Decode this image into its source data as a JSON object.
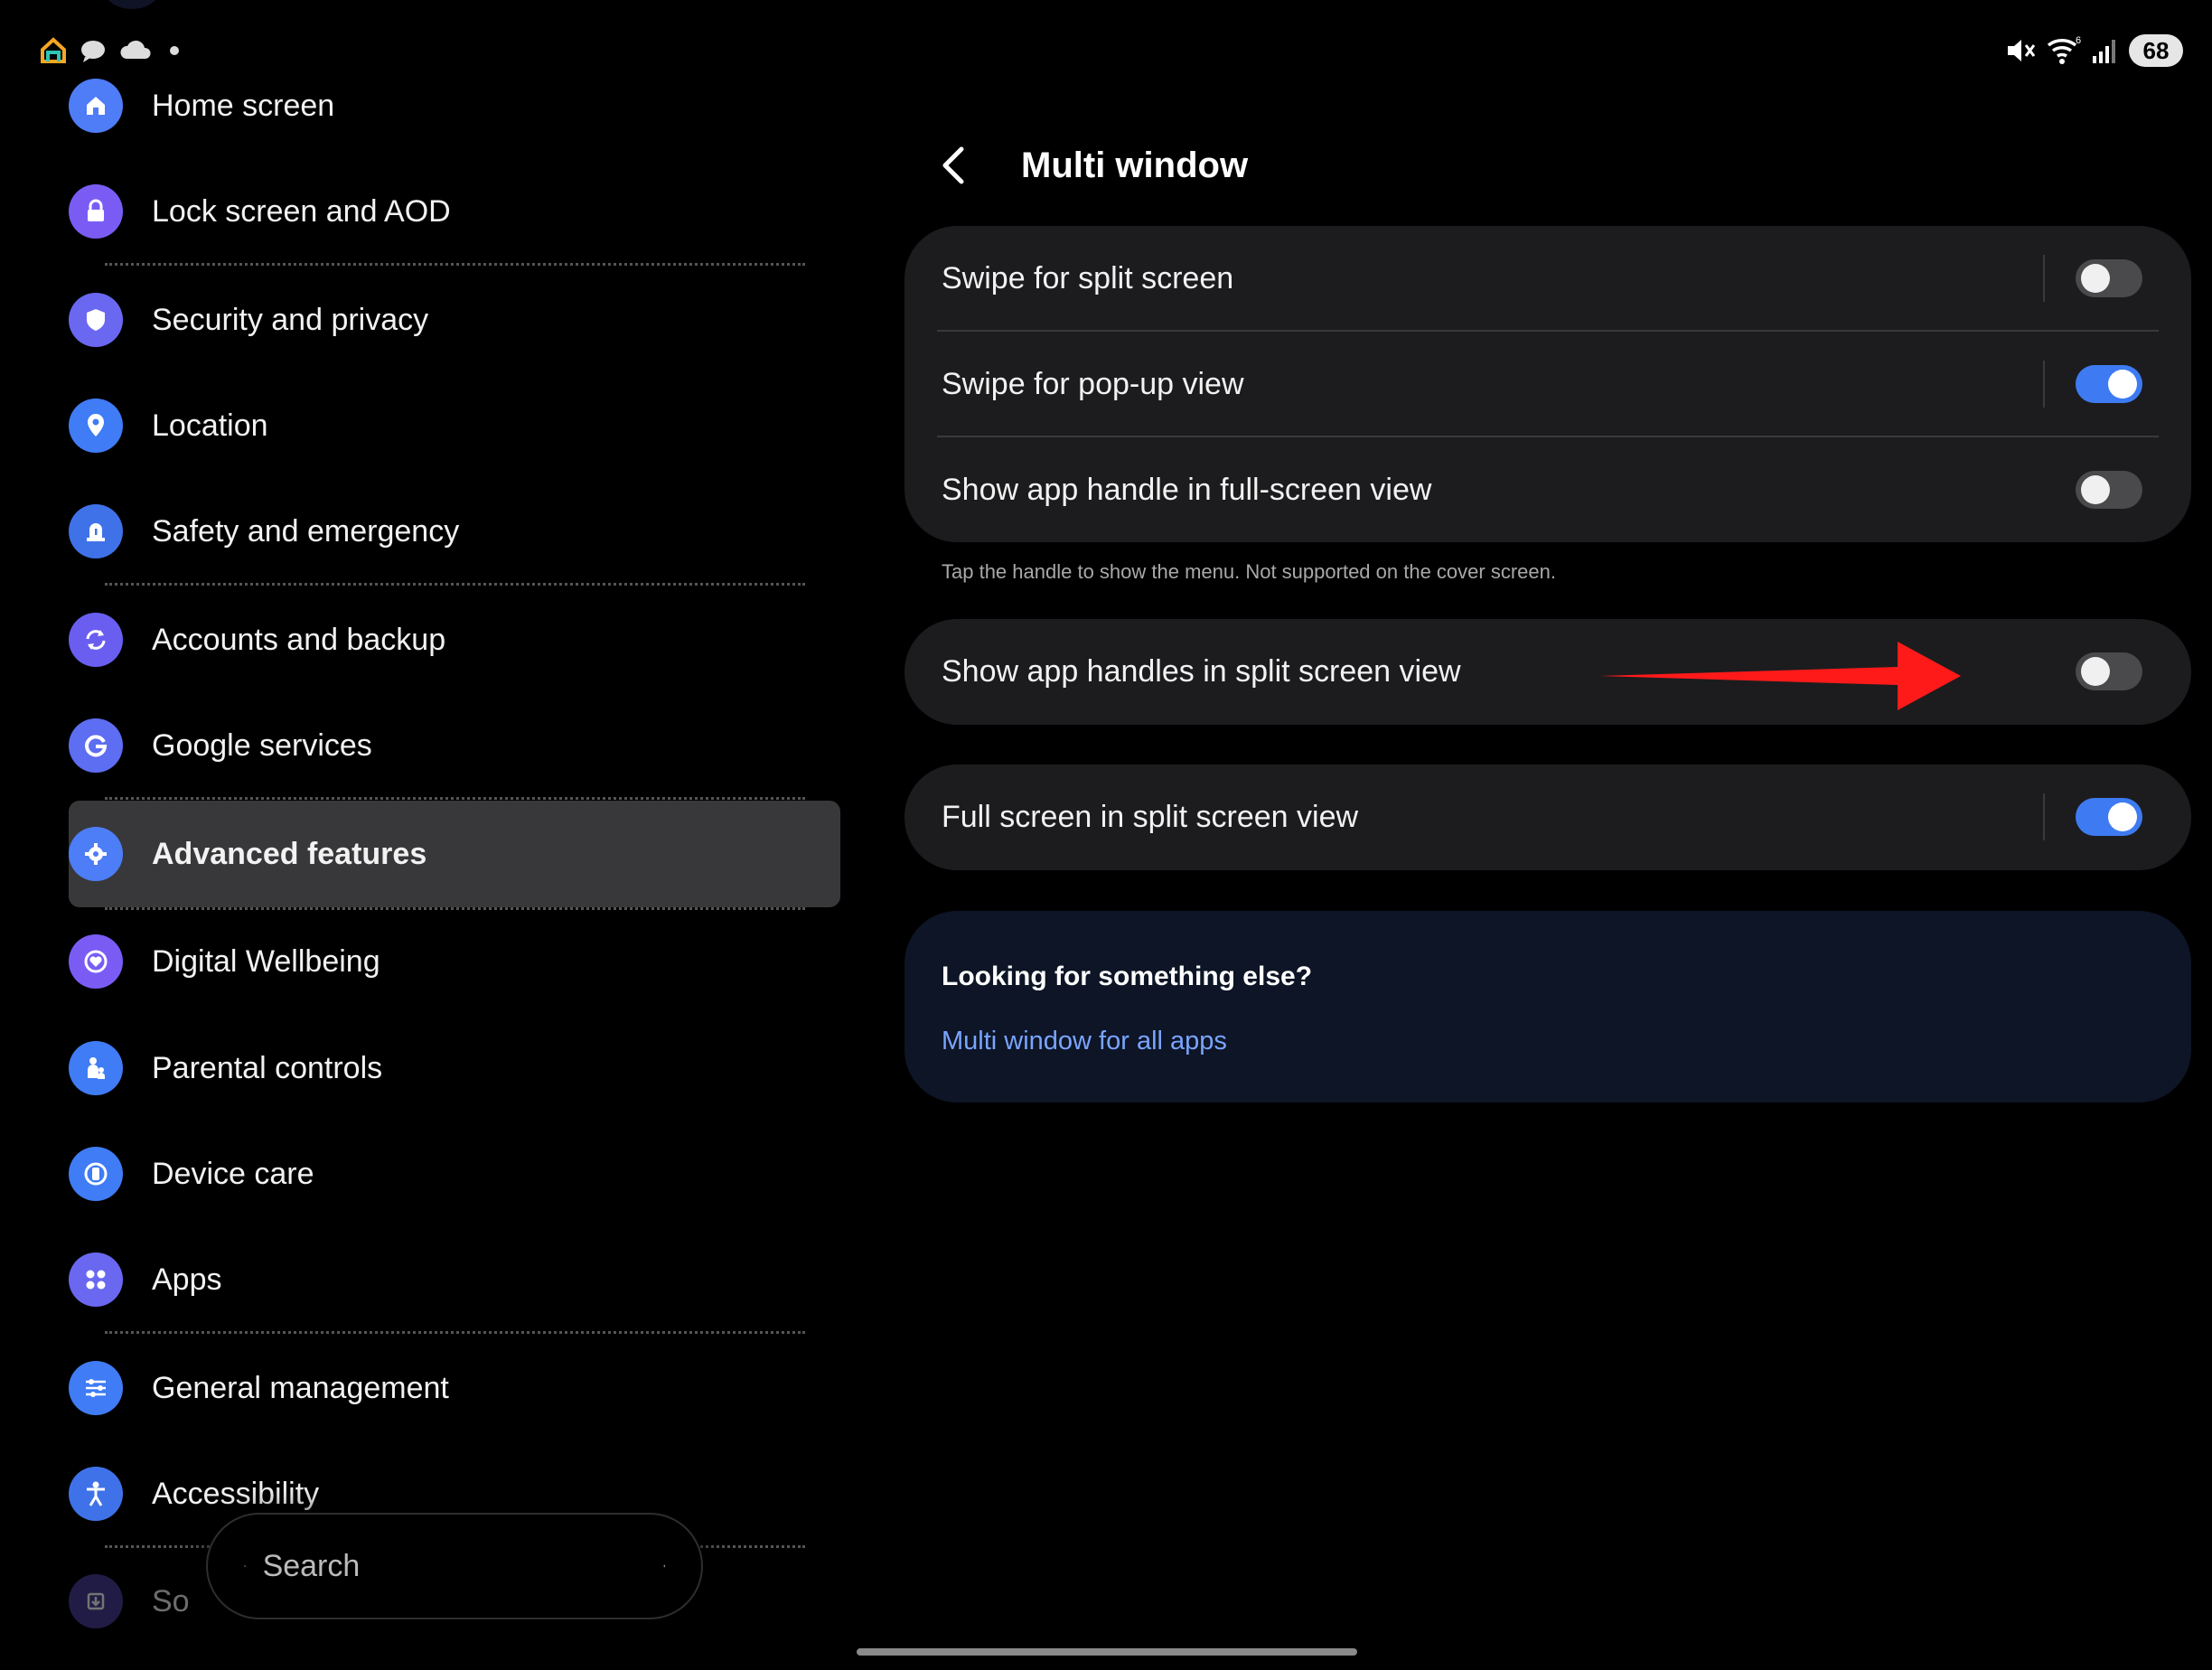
{
  "status": {
    "battery": "68",
    "left_icons": [
      "home-app-icon",
      "chat-bubble-icon",
      "cloud-icon",
      "dot-icon"
    ],
    "right_icons": [
      "mute-icon",
      "wifi-icon",
      "signal-icon"
    ]
  },
  "sidebar": {
    "items": [
      {
        "label": "Home screen",
        "icon": "home-icon",
        "color": "#4f7cf7"
      },
      {
        "label": "Lock screen and AOD",
        "icon": "lock-icon",
        "color": "#7a5cf5"
      },
      {
        "label": "Security and privacy",
        "icon": "shield-icon",
        "color": "#6a68f0"
      },
      {
        "label": "Location",
        "icon": "location-pin-icon",
        "color": "#3f7cf5"
      },
      {
        "label": "Safety and emergency",
        "icon": "siren-icon",
        "color": "#3f72e8"
      },
      {
        "label": "Accounts and backup",
        "icon": "sync-icon",
        "color": "#6a5ef0"
      },
      {
        "label": "Google services",
        "icon": "google-g-icon",
        "color": "#5d6ef2"
      },
      {
        "label": "Advanced features",
        "icon": "puzzle-gear-icon",
        "color": "#4d7ef7"
      },
      {
        "label": "Digital Wellbeing",
        "icon": "heart-circle-icon",
        "color": "#7a5cf5"
      },
      {
        "label": "Parental controls",
        "icon": "parent-child-icon",
        "color": "#3f7cf5"
      },
      {
        "label": "Device care",
        "icon": "device-care-icon",
        "color": "#3f7cf5"
      },
      {
        "label": "Apps",
        "icon": "apps-grid-icon",
        "color": "#6a68f0"
      },
      {
        "label": "General management",
        "icon": "sliders-icon",
        "color": "#3f7cf5"
      },
      {
        "label": "Accessibility",
        "icon": "accessibility-icon",
        "color": "#3f72e8"
      },
      {
        "label": "So",
        "icon": "software-update-icon",
        "color": "#4a3f9a"
      }
    ],
    "active": "Advanced features"
  },
  "search": {
    "placeholder": "Search"
  },
  "main": {
    "title": "Multi window",
    "group1": [
      {
        "label": "Swipe for split screen",
        "on": false
      },
      {
        "label": "Swipe for pop-up view",
        "on": true
      },
      {
        "label": "Show app handle in full-screen view",
        "on": false
      }
    ],
    "note": "Tap the handle to show the menu. Not supported on the cover screen.",
    "group2": {
      "label": "Show app handles in split screen view",
      "on": false
    },
    "group3": {
      "label": "Full screen in split screen view",
      "on": true
    },
    "help": {
      "heading": "Looking for something else?",
      "link": "Multi window for all apps"
    }
  },
  "colors": {
    "toggle_on": "#3e7bf2",
    "toggle_off": "#4a4a4c",
    "arrow": "#ff1a1a",
    "link": "#7aa4ff"
  }
}
